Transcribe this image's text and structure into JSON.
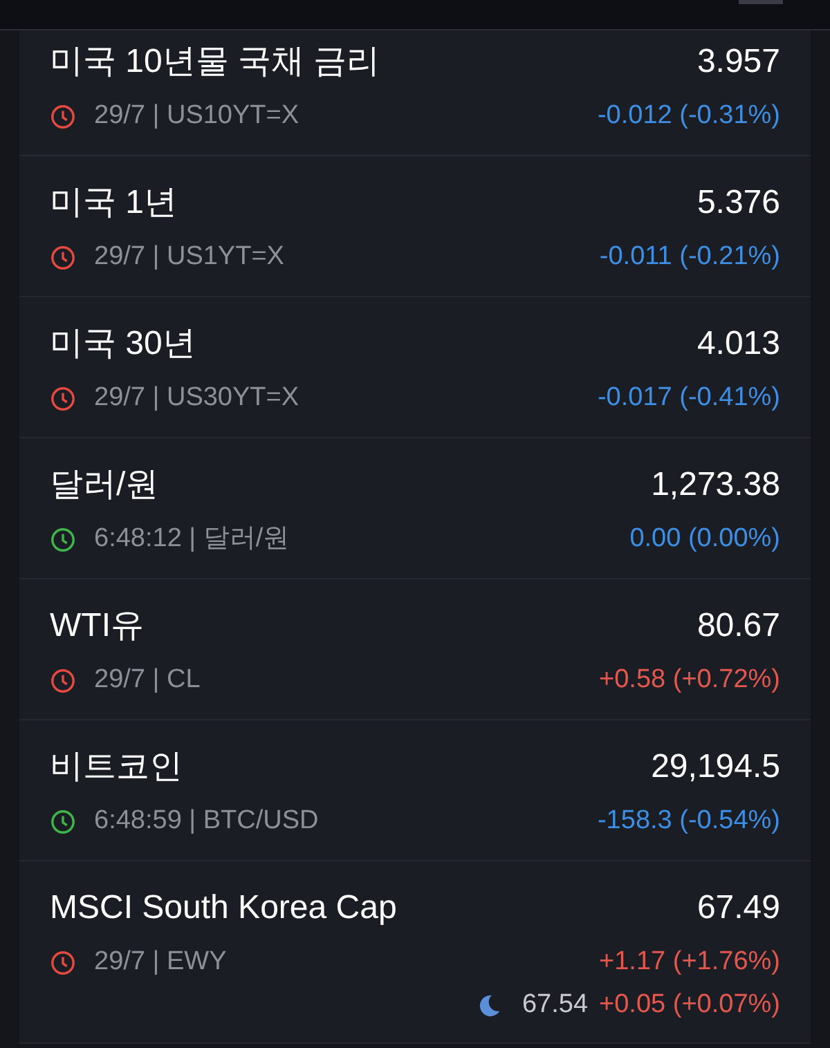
{
  "quotes": [
    {
      "name": "미국 10년물 국채 금리",
      "price": "3.957",
      "market_open": false,
      "meta": "29/7 | US10YT=X",
      "rising": false,
      "change": "-0.012 (-0.31%)"
    },
    {
      "name": "미국 1년",
      "price": "5.376",
      "market_open": false,
      "meta": "29/7 | US1YT=X",
      "rising": false,
      "change": "-0.011 (-0.21%)"
    },
    {
      "name": "미국 30년",
      "price": "4.013",
      "market_open": false,
      "meta": "29/7 | US30YT=X",
      "rising": false,
      "change": "-0.017 (-0.41%)"
    },
    {
      "name": "달러/원",
      "price": "1,273.38",
      "market_open": true,
      "meta": "6:48:12 | 달러/원",
      "rising": false,
      "change": "0.00 (0.00%)"
    },
    {
      "name": "WTI유",
      "price": "80.67",
      "market_open": false,
      "meta": "29/7 | CL",
      "rising": true,
      "change": "+0.58 (+0.72%)"
    },
    {
      "name": "비트코인",
      "price": "29,194.5",
      "market_open": true,
      "meta": "6:48:59 | BTC/USD",
      "rising": false,
      "change": "-158.3 (-0.54%)"
    },
    {
      "name": "MSCI South Korea Cap",
      "price": "67.49",
      "market_open": false,
      "meta": "29/7 | EWY",
      "rising": true,
      "change": "+1.17 (+1.76%)",
      "after_hours": {
        "price": "67.54",
        "rising": true,
        "change": "+0.05 (+0.07%)"
      }
    }
  ]
}
